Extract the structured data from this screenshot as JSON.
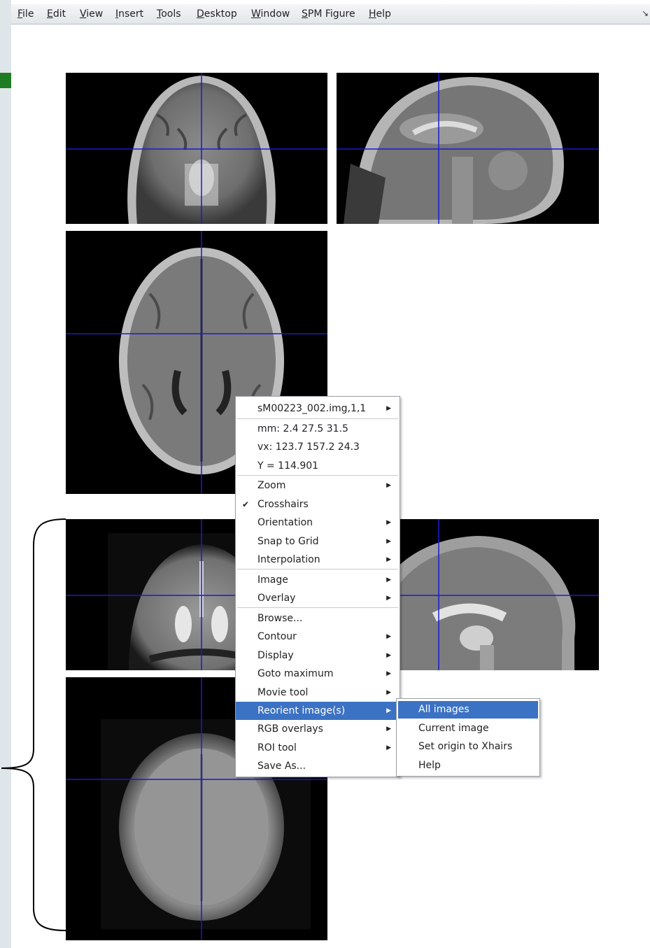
{
  "menubar": {
    "items": [
      {
        "mnemonic": "F",
        "rest": "ile"
      },
      {
        "mnemonic": "E",
        "rest": "dit"
      },
      {
        "mnemonic": "V",
        "rest": "iew"
      },
      {
        "mnemonic": "I",
        "rest": "nsert"
      },
      {
        "mnemonic": "T",
        "rest": "ools"
      },
      {
        "mnemonic": "D",
        "rest": "esktop"
      },
      {
        "mnemonic": "W",
        "rest": "indow"
      },
      {
        "mnemonic": "S",
        "rest": "PM Figure"
      },
      {
        "mnemonic": "H",
        "rest": "elp"
      }
    ],
    "corner_icon": "dock-arrow-icon"
  },
  "context_menu": {
    "header": "sM00223_002.img,1,1",
    "info": {
      "mm": "mm:  2.4 27.5 31.5",
      "vx": "vx:  123.7 157.2 24.3",
      "value": "Y = 114.901"
    },
    "group1": [
      {
        "label": "Zoom",
        "submenu": true,
        "checked": false
      },
      {
        "label": "Crosshairs",
        "submenu": false,
        "checked": true
      },
      {
        "label": "Orientation",
        "submenu": true,
        "checked": false
      },
      {
        "label": "Snap to Grid",
        "submenu": true,
        "checked": false
      },
      {
        "label": "Interpolation",
        "submenu": true,
        "checked": false
      }
    ],
    "group2": [
      {
        "label": "Image",
        "submenu": true
      },
      {
        "label": "Overlay",
        "submenu": true
      }
    ],
    "group3": [
      {
        "label": "Browse...",
        "submenu": false,
        "active": false
      },
      {
        "label": "Contour",
        "submenu": true,
        "active": false
      },
      {
        "label": "Display",
        "submenu": true,
        "active": false
      },
      {
        "label": "Goto maximum",
        "submenu": true,
        "active": false
      },
      {
        "label": "Movie tool",
        "submenu": true,
        "active": false
      },
      {
        "label": "Reorient image(s)",
        "submenu": true,
        "active": true
      },
      {
        "label": "RGB overlays",
        "submenu": true,
        "active": false
      },
      {
        "label": "ROI tool",
        "submenu": true,
        "active": false
      },
      {
        "label": "Save As...",
        "submenu": false,
        "active": false
      }
    ]
  },
  "submenu": {
    "items": [
      {
        "label": "All images",
        "active": true
      },
      {
        "label": "Current image",
        "active": false
      },
      {
        "label": "Set origin to Xhairs",
        "active": false
      },
      {
        "label": "Help",
        "active": false
      }
    ]
  },
  "colors": {
    "crosshair": "#1a1acf",
    "highlight": "#3b72c4",
    "panel_bg": "#000000"
  }
}
